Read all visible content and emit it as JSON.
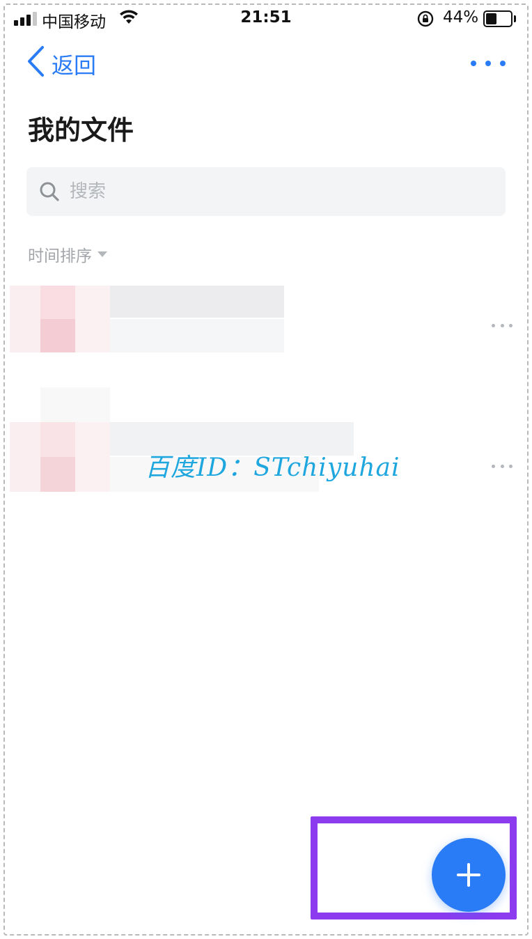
{
  "status_bar": {
    "carrier": "中国移动",
    "time": "21:51",
    "battery_percent": "44%",
    "battery_level": 0.44
  },
  "nav": {
    "back_label": "返回",
    "back_icon": "chevron-left-icon",
    "more_icon": "more-horizontal-icon"
  },
  "page": {
    "title": "我的文件"
  },
  "search": {
    "placeholder": "搜索",
    "value": ""
  },
  "sort": {
    "label": "时间排序"
  },
  "files": [
    {
      "name": "",
      "meta": ""
    },
    {
      "name": "",
      "meta": ""
    }
  ],
  "watermark": "百度ID：STchiyuhai",
  "fab": {
    "icon": "plus-icon"
  },
  "colors": {
    "accent": "#2a7cf6",
    "highlight": "#8d3bef",
    "watermark": "#1ea6df",
    "search_bg": "#f3f4f5"
  }
}
